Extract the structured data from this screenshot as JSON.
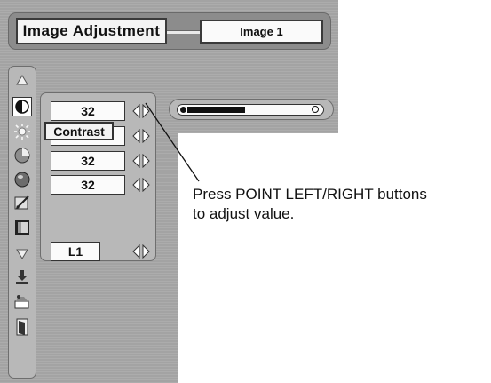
{
  "menu": {
    "title": "Image Adjustment",
    "source": "Image 1"
  },
  "sidebar": {
    "icons": [
      {
        "name": "scroll-up-icon"
      },
      {
        "name": "contrast-icon"
      },
      {
        "name": "brightness-icon"
      },
      {
        "name": "color-icon"
      },
      {
        "name": "tint-icon"
      },
      {
        "name": "sharpness-icon"
      },
      {
        "name": "gamma-icon"
      },
      {
        "name": "scroll-down-icon"
      },
      {
        "name": "store-icon"
      },
      {
        "name": "reset-icon"
      },
      {
        "name": "quit-icon"
      }
    ]
  },
  "values": {
    "contrast": "32",
    "color": "32",
    "tint": "32",
    "gamma": "L1"
  },
  "tooltip": "Contrast",
  "slider": {
    "level_fraction": 0.43
  },
  "callout": {
    "line1": "Press POINT LEFT/RIGHT buttons",
    "line2": "to adjust value."
  },
  "colors": {
    "panel": "#b8b8b8",
    "background": "#a3a3a3"
  }
}
